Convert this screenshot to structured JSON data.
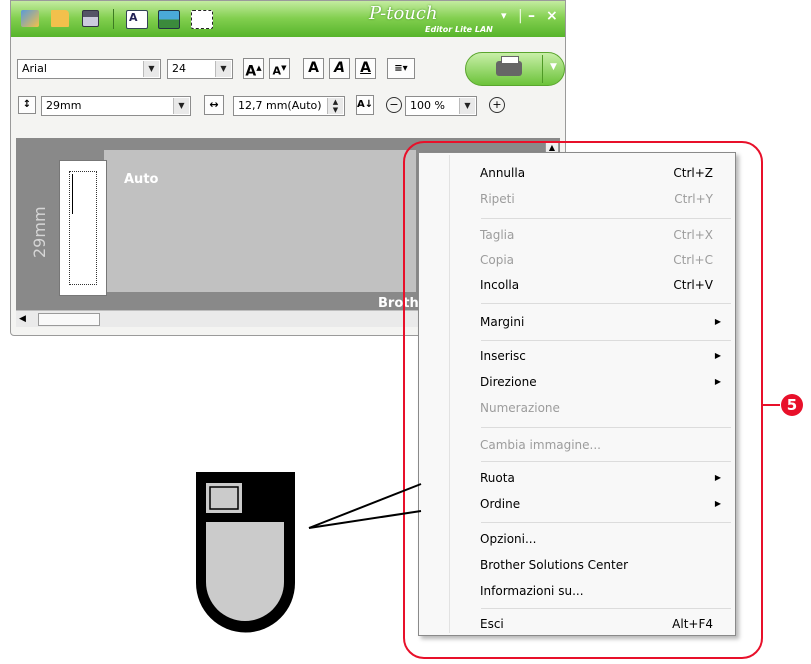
{
  "app": {
    "logo": "P-touch",
    "logo_sub": "Editor Lite LAN",
    "controls": {
      "minimize_dropdown": "▾",
      "minimize": "–",
      "close": "×"
    }
  },
  "icons": {
    "toolbar": [
      "new-label-icon",
      "open-folder-icon",
      "save-icon",
      "text-box-icon",
      "image-icon",
      "frame-icon"
    ],
    "font_buttons": [
      "font-grow-icon",
      "font-shrink-icon",
      "bold-icon",
      "italic-icon",
      "underline-icon",
      "align-icon"
    ],
    "print": "printer-icon"
  },
  "font_toolbar": {
    "font_name": "Arial",
    "font_size": "24",
    "grow": "A",
    "shrink": "A",
    "bold": "A",
    "italic": "A",
    "underline": "A"
  },
  "size_toolbar": {
    "tape_width": "29mm",
    "label_length": "12,7 mm(Auto)",
    "zoom": "100 %",
    "zoom_out": "−",
    "zoom_in": "+"
  },
  "editor": {
    "length_mode": "Auto",
    "tape_label": "29mm",
    "brand_partial": "Brothe"
  },
  "context_menu": {
    "items": [
      {
        "label": "Annulla",
        "shortcut": "Ctrl+Z",
        "enabled": true
      },
      {
        "label": "Ripeti",
        "shortcut": "Ctrl+Y",
        "enabled": false
      },
      {
        "label": "Taglia",
        "shortcut": "Ctrl+X",
        "enabled": false
      },
      {
        "label": "Copia",
        "shortcut": "Ctrl+C",
        "enabled": false
      },
      {
        "label": "Incolla",
        "shortcut": "Ctrl+V",
        "enabled": true
      },
      {
        "label": "Margini",
        "submenu": true,
        "enabled": true
      },
      {
        "label": "Inserisc",
        "submenu": true,
        "enabled": true
      },
      {
        "label": "Direzione",
        "submenu": true,
        "enabled": true
      },
      {
        "label": "Numerazione",
        "enabled": false
      },
      {
        "label": "Cambia immagine...",
        "enabled": false
      },
      {
        "label": "Ruota",
        "submenu": true,
        "enabled": true
      },
      {
        "label": "Ordine",
        "submenu": true,
        "enabled": true
      },
      {
        "label": "Opzioni...",
        "enabled": true
      },
      {
        "label": "Brother Solutions Center",
        "enabled": true
      },
      {
        "label": "Informazioni su...",
        "enabled": true
      },
      {
        "label": "Esci",
        "shortcut": "Alt+F4",
        "enabled": true
      }
    ]
  },
  "callout": {
    "step_number": "5",
    "highlight_color": "#e8102a",
    "icon": "mouse-right-click-icon"
  },
  "colors": {
    "titlebar": "#6cc33a",
    "editor_bg": "#898989",
    "label_bg": "#c1c1c1"
  }
}
